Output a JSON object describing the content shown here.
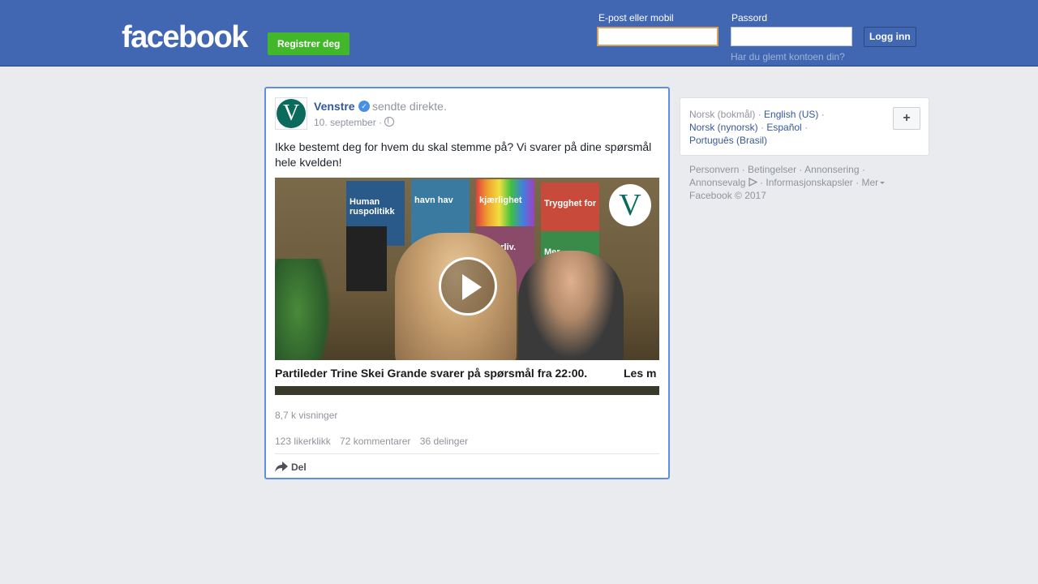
{
  "header": {
    "logo": "facebook",
    "register_label": "Registrer deg",
    "email_label": "E-post eller mobil",
    "email_value": "",
    "password_label": "Passord",
    "password_value": "",
    "login_label": "Logg inn",
    "forgot_label": "Har du glemt kontoen din?"
  },
  "post": {
    "avatar_letter": "V",
    "author": "Venstre",
    "action": "sendte direkte.",
    "date": "10. september ·",
    "text": "Ikke bestemt deg for hvem du skal stemme på? Vi svarer på dine spørsmål hele kvelden!",
    "video": {
      "logo_letter": "V",
      "posters": [
        "Human ruspolitikk",
        "havn hav",
        "kjærlighet",
        "Trygghet for",
        "kulturliv.",
        "Mer"
      ],
      "caption": "Partileder Trine Skei Grande svarer på spørsmål fra 22:00.",
      "caption_more": "Les m",
      "play_icon": "play-icon"
    },
    "views": "8,7 k visninger",
    "likes": "123 likerklikk",
    "comments": "72 kommentarer",
    "shares": "36 delinger",
    "share_label": "Del"
  },
  "languages": {
    "current": "Norsk (bokmål)",
    "items": [
      "English (US)",
      "Norsk (nynorsk)",
      "Español",
      "Português (Brasil)"
    ],
    "add_icon": "plus-icon"
  },
  "footer": {
    "privacy": "Personvern",
    "terms": "Betingelser",
    "advertising": "Annonsering",
    "adchoices": "Annonsevalg",
    "cookies": "Informasjonskapsler",
    "more": "Mer",
    "copyright": "Facebook © 2017"
  },
  "colors": {
    "header_bg": "#4267b2",
    "register_green": "#42b72a",
    "link_blue": "#365899",
    "post_border_focus": "#5b8fe8"
  }
}
